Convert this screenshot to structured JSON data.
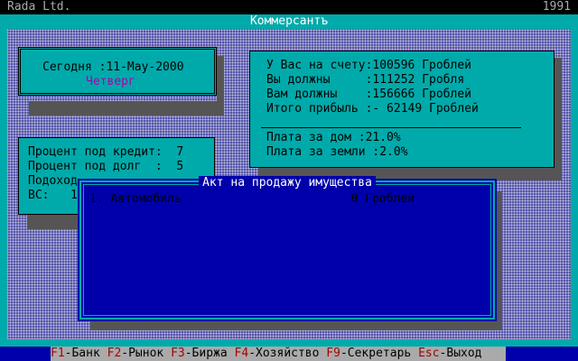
{
  "header": {
    "company": "Rada Ltd.",
    "year": "1991"
  },
  "window_title": "Коммерсантъ",
  "date_box": {
    "today_label": "Сегодня :11-May-2000",
    "weekday": "Четверг"
  },
  "account_box": {
    "lines": [
      "У Вас на счету:100596 Гроблей",
      "Вы должны     :111252 Гробля",
      "Вам должны    :156666 Гроблей",
      "Итого прибыль :- 62149 Гроблей"
    ],
    "fees": [
      "Плата за дом :21.0%",
      "Плата за земли :2.0%"
    ]
  },
  "rates_box": {
    "lines": [
      "Процент под кредит:  7",
      "Процент под долг  :  5",
      "Подоход",
      "ВС:   1"
    ]
  },
  "dialog": {
    "title": "Акт на продажу имущества",
    "items": [
      {
        "text": "1. Автомобиль                        0 Гроблей"
      }
    ]
  },
  "statusbar": {
    "items": [
      {
        "key": "F1",
        "label": "-Банк"
      },
      {
        "key": "F2",
        "label": "-Рынок"
      },
      {
        "key": "F3",
        "label": "-Биржа"
      },
      {
        "key": "F4",
        "label": "-Хозяйство"
      },
      {
        "key": "F9",
        "label": "-Секретарь"
      },
      {
        "key": "Esc",
        "label": "-Выход"
      }
    ]
  },
  "colors": {
    "desktop": "#00aaaa",
    "dialog": "#0000aa",
    "hotkey": "#aa0000",
    "accent_purple": "#aa00aa"
  }
}
